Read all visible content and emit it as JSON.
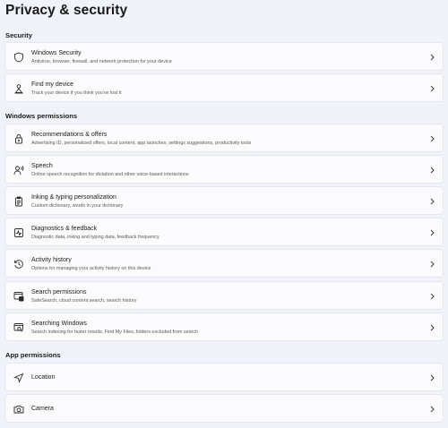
{
  "page": {
    "title": "Privacy & security"
  },
  "sections": {
    "security": "Security",
    "windows_permissions": "Windows permissions",
    "app_permissions": "App permissions"
  },
  "items": {
    "windows_security": {
      "title": "Windows Security",
      "subtitle": "Antivirus, browser, firewall, and network protection for your device",
      "icon": "shield-icon"
    },
    "find_my_device": {
      "title": "Find my device",
      "subtitle": "Track your device if you think you've lost it",
      "icon": "person-pin-icon"
    },
    "recommendations": {
      "title": "Recommendations & offers",
      "subtitle": "Advertising ID, personalized offers, local content, app launches, settings suggestions, productivity tools",
      "icon": "lock-icon"
    },
    "speech": {
      "title": "Speech",
      "subtitle": "Online speech recognition for dictation and other voice-based interactions",
      "icon": "speech-icon"
    },
    "inking": {
      "title": "Inking & typing personalization",
      "subtitle": "Custom dictionary, words in your dictionary",
      "icon": "clipboard-icon"
    },
    "diagnostics": {
      "title": "Diagnostics & feedback",
      "subtitle": "Diagnostic data, inking and typing data, feedback frequency",
      "icon": "diagnostics-icon"
    },
    "activity": {
      "title": "Activity history",
      "subtitle": "Options for managing your activity history on this device",
      "icon": "history-icon"
    },
    "search_permissions": {
      "title": "Search permissions",
      "subtitle": "SafeSearch, cloud content search, search history",
      "icon": "search-permissions-icon"
    },
    "searching_windows": {
      "title": "Searching Windows",
      "subtitle": "Search indexing for faster results, Find My Files, folders excluded from search",
      "icon": "search-windows-icon"
    },
    "location": {
      "title": "Location",
      "icon": "location-icon"
    },
    "camera": {
      "title": "Camera",
      "icon": "camera-icon"
    }
  }
}
